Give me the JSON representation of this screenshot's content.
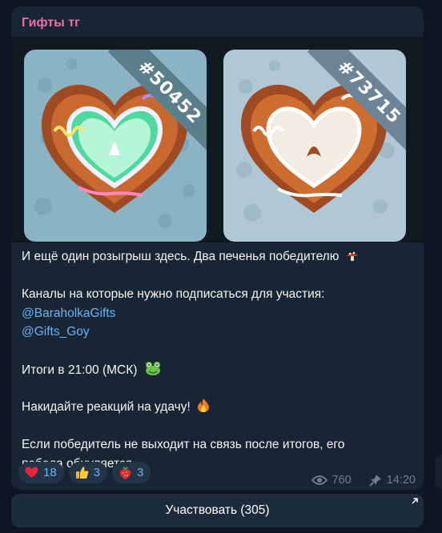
{
  "channel": {
    "name": "Гифты тг",
    "name_color": "#ee6fa5"
  },
  "gifts": [
    {
      "number": "#50452",
      "icon": "gingerbread-heart-icon"
    },
    {
      "number": "#73715",
      "icon": "gingerbread-heart-icon"
    }
  ],
  "post": {
    "line1": "И ещё один розыгрыш здесь. Два печенья победителю",
    "line1_emoji": "mushroom-icon",
    "line2": "Каналы на которые нужно подписаться для участия:",
    "link1": "@BaraholkaGifts",
    "link2": "@Gifts_Goy",
    "line3": "Итоги в 21:00 (МСК)",
    "line3_emoji": "frog-icon",
    "line4": "Накидайте реакций на удачу!",
    "line4_emoji": "fire-icon",
    "line5": "Если победитель не выходит на связь после итогов, его",
    "line6": "победа обнуляется"
  },
  "reactions": [
    {
      "icon": "red-heart-icon",
      "count": "18"
    },
    {
      "icon": "thumbs-up-icon",
      "count": "3"
    },
    {
      "icon": "strawberry-icon",
      "count": "3"
    }
  ],
  "meta": {
    "views": "760",
    "time": "14:20"
  },
  "action_button": {
    "label": "Участвовать (305)"
  },
  "colors": {
    "accent": "#6ab3f3",
    "bubble": "#182533",
    "background": "#0e1621"
  }
}
